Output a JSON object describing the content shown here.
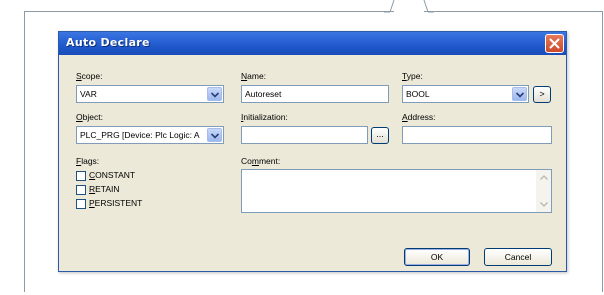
{
  "dialog": {
    "title": "Auto Declare",
    "close_icon": "close-icon"
  },
  "scope": {
    "label_u": "S",
    "label_rest": "cope:",
    "value": "VAR"
  },
  "name": {
    "label_u": "N",
    "label_rest": "ame:",
    "value": "Autoreset"
  },
  "type": {
    "label_u": "T",
    "label_rest": "ype:",
    "value": "BOOL",
    "browse_label": ">"
  },
  "object": {
    "label_u": "O",
    "label_rest": "bject:",
    "value": "PLC_PRG [Device: Plc Logic: A"
  },
  "initialization": {
    "label_u": "I",
    "label_rest": "nitialization:",
    "value": "",
    "browse_label": "..."
  },
  "address": {
    "label_u": "A",
    "label_rest": "ddress:",
    "value": ""
  },
  "flags": {
    "label_u": "F",
    "label_rest": "lags:",
    "items": [
      {
        "u": "C",
        "rest": "ONSTANT",
        "checked": false
      },
      {
        "u": "R",
        "rest": "ETAIN",
        "checked": false
      },
      {
        "u": "P",
        "rest": "ERSISTENT",
        "checked": false
      }
    ]
  },
  "comment": {
    "label_pre": "Co",
    "label_u": "m",
    "label_rest": "ment:",
    "value": ""
  },
  "buttons": {
    "ok": "OK",
    "cancel": "Cancel"
  },
  "colors": {
    "title_bar": "#2c66d8",
    "dialog_bg": "#ece9d8",
    "close_button": "#d4583a"
  }
}
